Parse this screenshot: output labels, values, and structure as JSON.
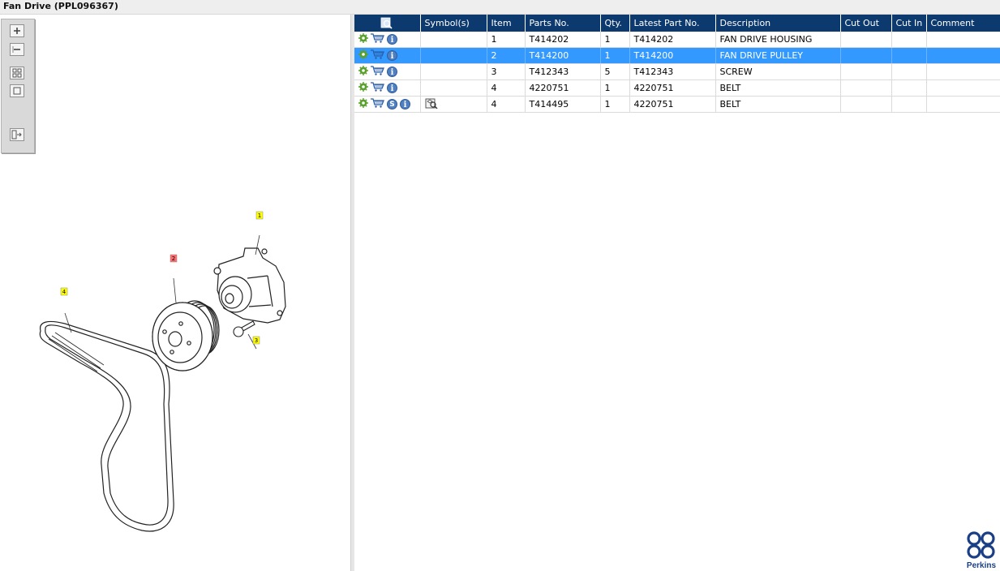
{
  "window": {
    "title": "Fan Drive (PPL096367)"
  },
  "toolbar": {
    "icons": [
      "zoom-in-icon",
      "zoom-out-icon",
      "fit-all-icon",
      "fit-window-icon",
      "list-view-icon"
    ]
  },
  "diagram": {
    "callouts": [
      "1",
      "2",
      "3",
      "4"
    ],
    "callout_colors": {
      "normal": "#ffff00",
      "selected": "#ff6f6f"
    }
  },
  "grid": {
    "columns": [
      "",
      "Symbol(s)",
      "Item",
      "Parts No.",
      "Qty.",
      "Latest Part No.",
      "Description",
      "Cut Out",
      "Cut In",
      "Comment"
    ],
    "rows": [
      {
        "item": "1",
        "part_no": "T414202",
        "qty": "1",
        "latest_part_no": "T414202",
        "description": "FAN DRIVE HOUSING",
        "cut_out": "",
        "cut_in": "",
        "comment": "",
        "icons": [
          "gear-icon",
          "cart-icon",
          "info-icon"
        ],
        "symbols": []
      },
      {
        "item": "2",
        "part_no": "T414200",
        "qty": "1",
        "latest_part_no": "T414200",
        "description": "FAN DRIVE PULLEY",
        "cut_out": "",
        "cut_in": "",
        "comment": "",
        "icons": [
          "gear-icon",
          "cart-icon",
          "info-icon"
        ],
        "symbols": [],
        "selected": true
      },
      {
        "item": "3",
        "part_no": "T412343",
        "qty": "5",
        "latest_part_no": "T412343",
        "description": "SCREW",
        "cut_out": "",
        "cut_in": "",
        "comment": "",
        "icons": [
          "gear-icon",
          "cart-icon",
          "info-icon"
        ],
        "symbols": []
      },
      {
        "item": "4",
        "part_no": "4220751",
        "qty": "1",
        "latest_part_no": "4220751",
        "description": "BELT",
        "cut_out": "",
        "cut_in": "",
        "comment": "",
        "icons": [
          "gear-icon",
          "cart-icon",
          "info-icon"
        ],
        "symbols": []
      },
      {
        "item": "4",
        "part_no": "T414495",
        "qty": "1",
        "latest_part_no": "4220751",
        "description": "BELT",
        "cut_out": "",
        "cut_in": "",
        "comment": "",
        "icons": [
          "gear-icon",
          "cart-icon",
          "s-icon",
          "info-icon"
        ],
        "symbols": [
          "view-part-icon"
        ]
      }
    ]
  },
  "brand": {
    "name": "Perkins",
    "color": "#1b3f86"
  },
  "colors": {
    "header_bg": "#0d3a6e",
    "selection_bg": "#3399ff"
  }
}
